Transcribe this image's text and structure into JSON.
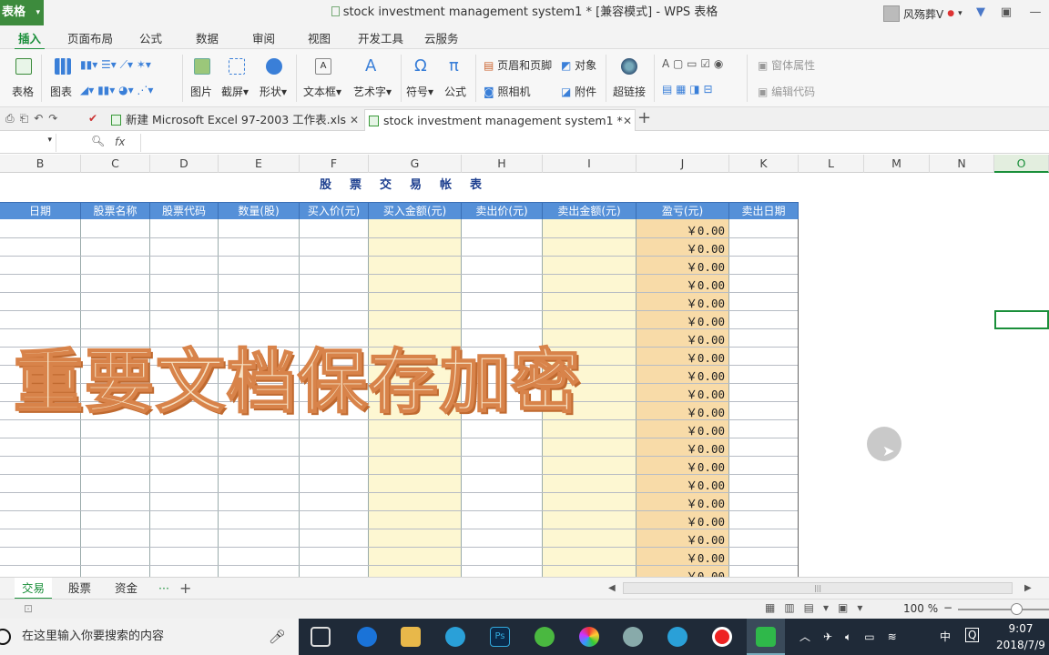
{
  "app": {
    "badge": "表格",
    "window_title": "stock investment management system1 * [兼容模式] - WPS 表格",
    "user_name": "风殇葬V"
  },
  "menu_tabs": [
    "插入",
    "页面布局",
    "公式",
    "数据",
    "审阅",
    "视图",
    "开发工具",
    "云服务"
  ],
  "active_menu_tab": "插入",
  "ribbon": {
    "table": "表格",
    "chart": "图表",
    "picture": "图片",
    "screenshot": "截屏",
    "shape": "形状",
    "textbox": "文本框",
    "wordart": "艺术字",
    "symbol": "符号",
    "formula": "公式",
    "header_footer": "页眉和页脚",
    "object": "对象",
    "camera": "照相机",
    "attachment": "附件",
    "hyperlink": "超链接",
    "window_props": "窗体属性",
    "edit_code": "编辑代码"
  },
  "doc_tabs": [
    {
      "label": "新建 Microsoft Excel 97-2003 工作表.xls",
      "active": false
    },
    {
      "label": "stock investment management system1 *",
      "active": true
    }
  ],
  "formula_bar": {
    "fx": "fx"
  },
  "columns": [
    "B",
    "C",
    "D",
    "E",
    "F",
    "G",
    "H",
    "I",
    "J",
    "K",
    "L",
    "M",
    "N",
    "O"
  ],
  "selected_column": "O",
  "sheet": {
    "title": "股票交易帐表",
    "headers": [
      "日期",
      "股票名称",
      "股票代码",
      "数量(股)",
      "买入价(元)",
      "买入金额(元)",
      "卖出价(元)",
      "卖出金额(元)",
      "盈亏(元)",
      "卖出日期"
    ],
    "profit_values": [
      "￥0.00",
      "￥0.00",
      "￥0.00",
      "￥0.00",
      "￥0.00",
      "￥0.00",
      "￥0.00",
      "￥0.00",
      "￥0.00",
      "￥0.00",
      "￥0.00",
      "￥0.00",
      "￥0.00",
      "￥0.00",
      "￥0.00",
      "￥0.00",
      "￥0.00",
      "￥0.00",
      "￥0.00",
      "￥0.00"
    ]
  },
  "watermark": "重要文档保存加密",
  "sheet_tabs": [
    "交易",
    "股票",
    "资金"
  ],
  "active_sheet_tab": "交易",
  "status": {
    "zoom": "100 %"
  },
  "taskbar": {
    "search_placeholder": "在这里输入你要搜索的内容",
    "time": "9:07",
    "date": "2018/7/9",
    "ime": "中"
  },
  "colors": {
    "accent": "#1a8f3a",
    "header_blue": "#5590d8",
    "buy_amount_fill": "#fdf7d2",
    "profit_fill": "#f8dba8"
  }
}
